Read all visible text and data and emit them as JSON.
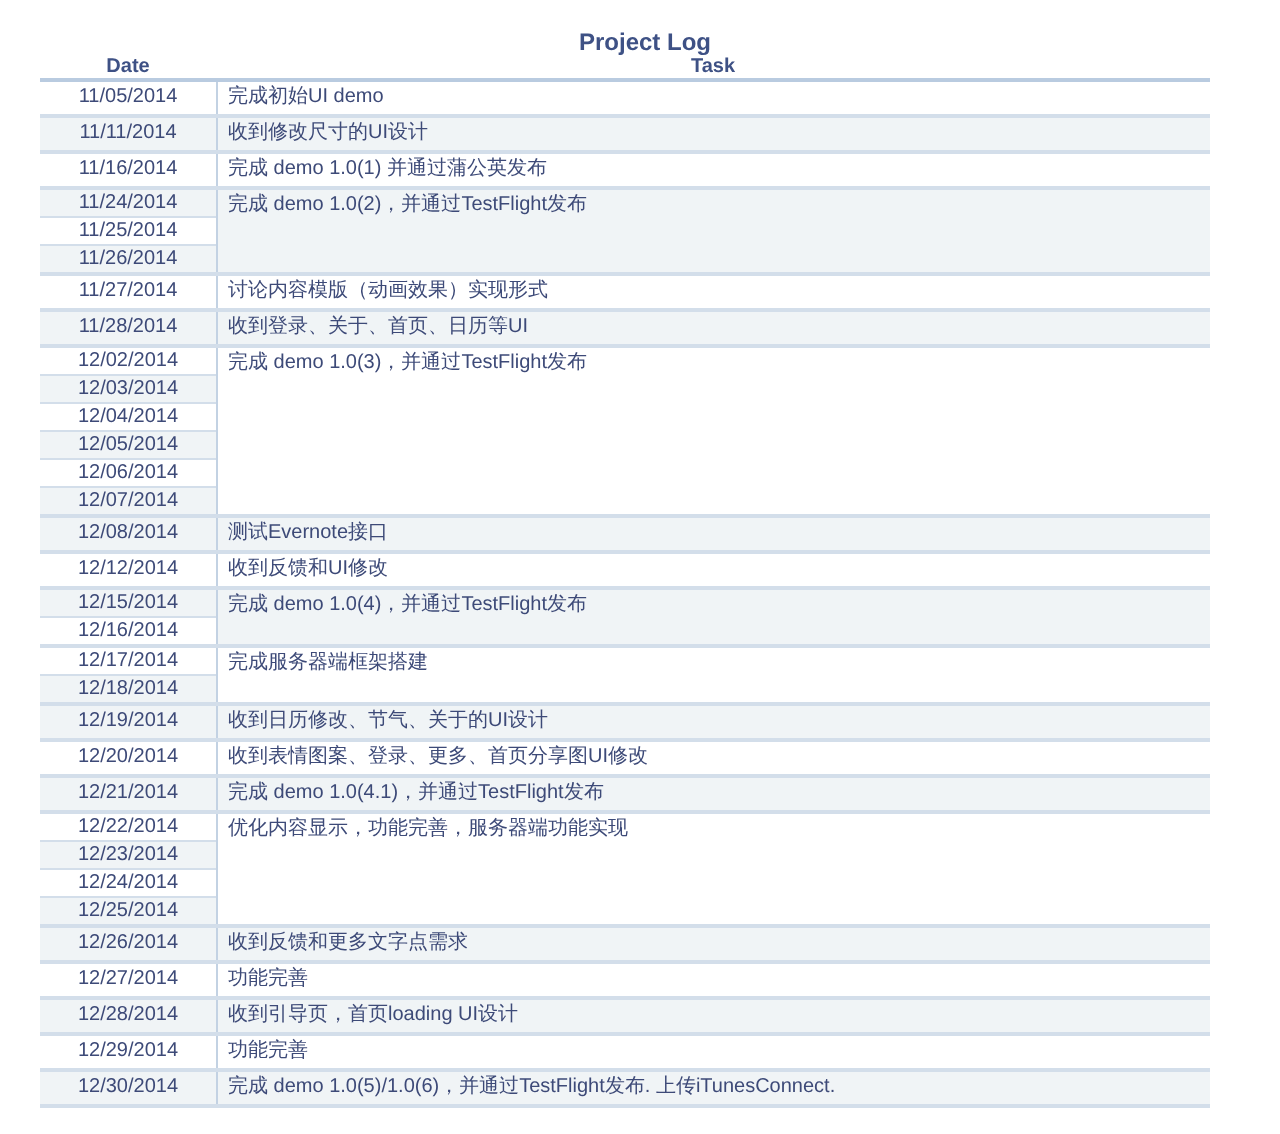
{
  "title": "Project Log",
  "columns": [
    "Date",
    "Task"
  ],
  "rows": [
    {
      "dates": [
        "11/05/2014"
      ],
      "task": "完成初始UI demo"
    },
    {
      "dates": [
        "11/11/2014"
      ],
      "task": "收到修改尺寸的UI设计"
    },
    {
      "dates": [
        "11/16/2014"
      ],
      "task": "完成 demo 1.0(1) 并通过蒲公英发布"
    },
    {
      "dates": [
        "11/24/2014",
        "11/25/2014",
        "11/26/2014"
      ],
      "task": "完成 demo 1.0(2)，并通过TestFlight发布"
    },
    {
      "dates": [
        "11/27/2014"
      ],
      "task": "讨论内容模版（动画效果）实现形式"
    },
    {
      "dates": [
        "11/28/2014"
      ],
      "task": "收到登录、关于、首页、日历等UI"
    },
    {
      "dates": [
        "12/02/2014",
        "12/03/2014",
        "12/04/2014",
        "12/05/2014",
        "12/06/2014",
        "12/07/2014"
      ],
      "task": "完成 demo 1.0(3)，并通过TestFlight发布"
    },
    {
      "dates": [
        "12/08/2014"
      ],
      "task": "测试Evernote接口"
    },
    {
      "dates": [
        "12/12/2014"
      ],
      "task": "收到反馈和UI修改"
    },
    {
      "dates": [
        "12/15/2014",
        "12/16/2014"
      ],
      "task": "完成 demo 1.0(4)，并通过TestFlight发布"
    },
    {
      "dates": [
        "12/17/2014",
        "12/18/2014"
      ],
      "task": "完成服务器端框架搭建"
    },
    {
      "dates": [
        "12/19/2014"
      ],
      "task": "收到日历修改、节气、关于的UI设计"
    },
    {
      "dates": [
        "12/20/2014"
      ],
      "task": "收到表情图案、登录、更多、首页分享图UI修改"
    },
    {
      "dates": [
        "12/21/2014"
      ],
      "task": "完成 demo 1.0(4.1)，并通过TestFlight发布"
    },
    {
      "dates": [
        "12/22/2014",
        "12/23/2014",
        "12/24/2014",
        "12/25/2014"
      ],
      "task": "优化内容显示，功能完善，服务器端功能实现"
    },
    {
      "dates": [
        "12/26/2014"
      ],
      "task": "收到反馈和更多文字点需求"
    },
    {
      "dates": [
        "12/27/2014"
      ],
      "task": "功能完善"
    },
    {
      "dates": [
        "12/28/2014"
      ],
      "task": "收到引导页，首页loading UI设计"
    },
    {
      "dates": [
        "12/29/2014"
      ],
      "task": "功能完善"
    },
    {
      "dates": [
        "12/30/2014"
      ],
      "task": "完成 demo 1.0(5)/1.0(6)，并通过TestFlight发布. 上传iTunesConnect."
    }
  ]
}
